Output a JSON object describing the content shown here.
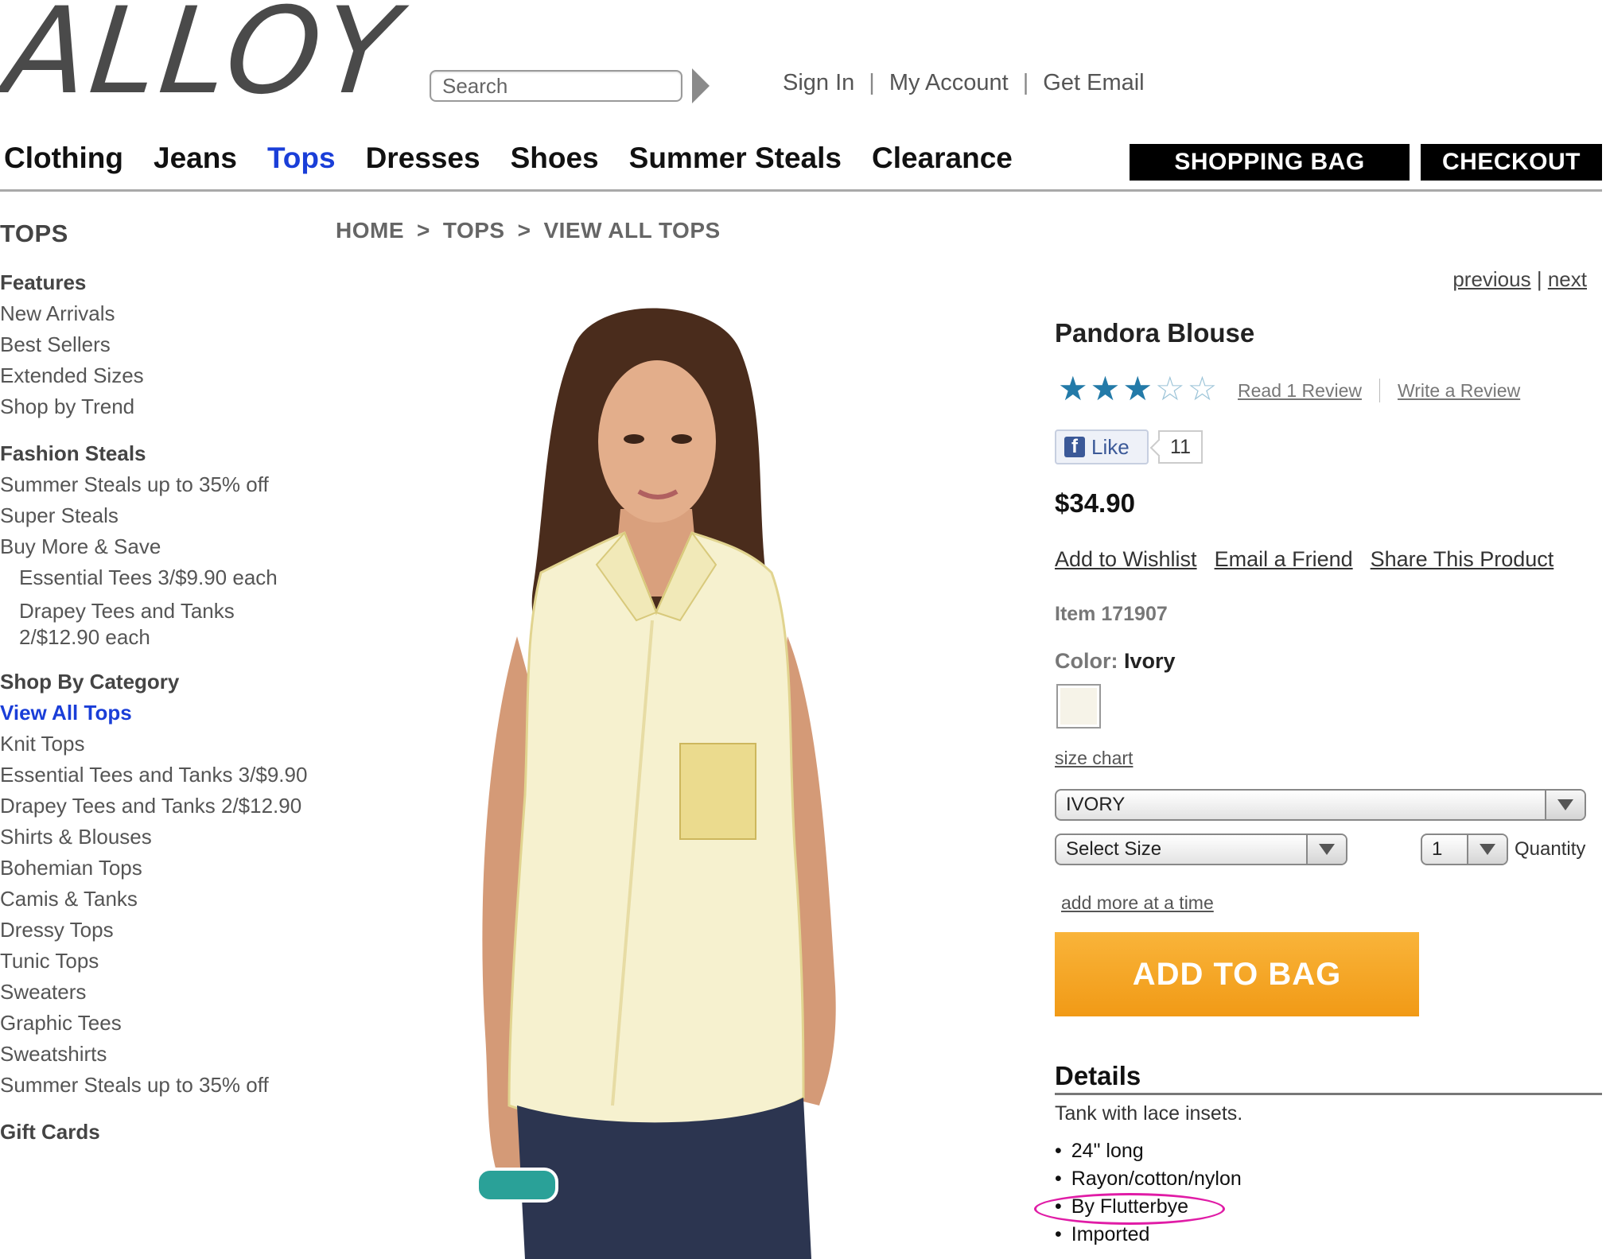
{
  "brand": {
    "logo_text": "ALLOY"
  },
  "search": {
    "placeholder": "Search"
  },
  "account": {
    "sign_in": "Sign In",
    "my_account": "My Account",
    "get_email": "Get Email",
    "separator": "|"
  },
  "nav": {
    "items": [
      "Clothing",
      "Jeans",
      "Tops",
      "Dresses",
      "Shoes",
      "Summer Steals",
      "Clearance"
    ],
    "active": "Tops",
    "shopping_bag": "SHOPPING BAG",
    "checkout": "CHECKOUT"
  },
  "sidebar": {
    "title": "TOPS",
    "sections": [
      {
        "heading": "Features",
        "items": [
          "New Arrivals",
          "Best Sellers",
          "Extended Sizes",
          "Shop by Trend"
        ]
      },
      {
        "heading": "Fashion Steals",
        "items": [
          "Summer Steals up to 35% off",
          "Super Steals",
          "Buy More & Save"
        ],
        "sub_items": [
          "Essential Tees 3/$9.90 each",
          "Drapey Tees and Tanks 2/$12.90 each"
        ]
      },
      {
        "heading": "Shop By Category",
        "active_item": "View All Tops",
        "items": [
          "Knit Tops",
          "Essential Tees and Tanks 3/$9.90",
          "Drapey Tees and Tanks 2/$12.90",
          "Shirts & Blouses",
          "Bohemian Tops",
          "Camis & Tanks",
          "Dressy Tops",
          "Tunic Tops",
          "Sweaters",
          "Graphic Tees",
          "Sweatshirts",
          "Summer Steals up to 35% off"
        ]
      },
      {
        "heading": "Gift Cards",
        "items": []
      }
    ]
  },
  "breadcrumb": [
    "HOME",
    "TOPS",
    "VIEW ALL TOPS"
  ],
  "breadcrumb_sep": ">",
  "pager": {
    "previous": "previous",
    "sep": "|",
    "next": "next"
  },
  "product": {
    "name": "Pandora Blouse",
    "rating": 3,
    "rating_max": 5,
    "read_reviews": "Read 1 Review",
    "write_review": "Write a Review",
    "like_label": "Like",
    "like_count": "11",
    "price": "$34.90",
    "actions": [
      "Add to Wishlist",
      "Email a Friend",
      "Share This Product"
    ],
    "item_number": "Item 171907",
    "color_label": "Color:",
    "color_value": "Ivory",
    "swatch_color": "#f6f3e8",
    "size_chart": "size chart",
    "color_select": "IVORY",
    "size_select": "Select Size",
    "quantity_value": "1",
    "quantity_label": "Quantity",
    "add_more": "add more at a time",
    "add_to_bag": "ADD TO BAG",
    "details_heading": "Details",
    "details_desc": "Tank with lace insets.",
    "details_bullets": [
      "24\" long",
      "Rayon/cotton/nylon",
      "By Flutterbye",
      "Imported"
    ]
  },
  "colors": {
    "active_link": "#1a3ed8",
    "star": "#237aa8",
    "add_to_bag": "#f5a623",
    "highlight": "#e01ca6"
  }
}
